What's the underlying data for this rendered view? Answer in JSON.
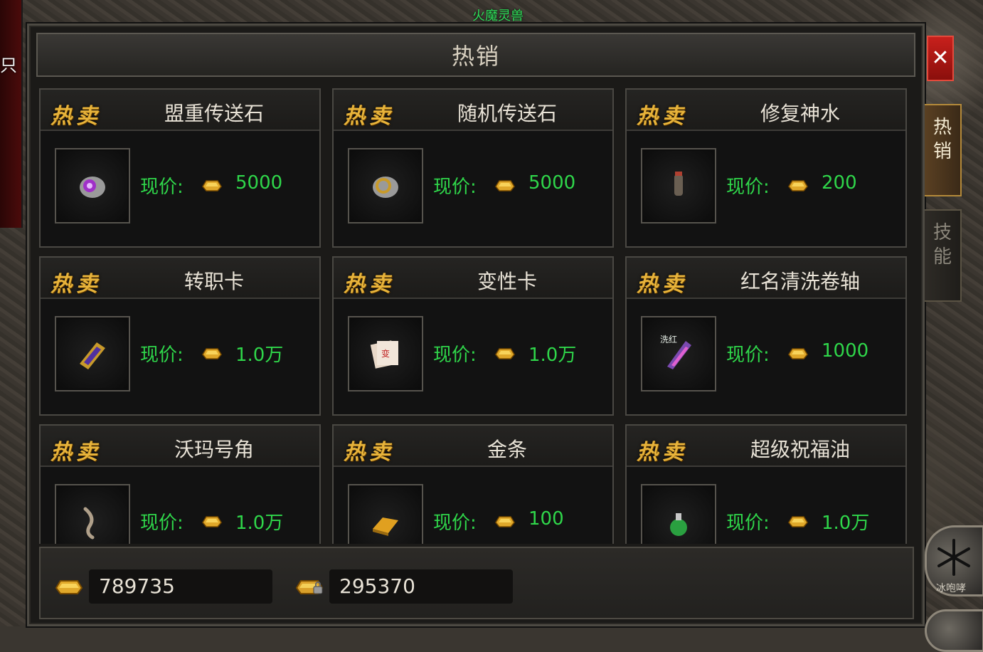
{
  "world": {
    "left_label": "只",
    "npc_name": "火魔灵兽"
  },
  "window": {
    "title": "热销"
  },
  "hot_label": "热卖",
  "price_label": "现价:",
  "items": [
    {
      "name": "盟重传送石",
      "price": "5000",
      "icon": "purple-teleport-stone-icon"
    },
    {
      "name": "随机传送石",
      "price": "5000",
      "icon": "random-teleport-stone-icon"
    },
    {
      "name": "修复神水",
      "price": "200",
      "icon": "repair-potion-icon"
    },
    {
      "name": "转职卡",
      "price": "1.0万",
      "icon": "class-change-card-icon"
    },
    {
      "name": "变性卡",
      "price": "1.0万",
      "icon": "gender-change-card-icon"
    },
    {
      "name": "红名清洗卷轴",
      "price": "1000",
      "icon": "red-name-scroll-icon",
      "icon_text": "洗红"
    },
    {
      "name": "沃玛号角",
      "price": "1.0万",
      "icon": "woma-horn-icon"
    },
    {
      "name": "金条",
      "price": "100",
      "icon": "gold-bar-icon"
    },
    {
      "name": "超级祝福油",
      "price": "1.0万",
      "icon": "blessing-oil-icon"
    }
  ],
  "footer": {
    "gold": "789735",
    "bound_gold": "295370"
  },
  "side_tabs": [
    {
      "label": "热销",
      "active": true
    },
    {
      "label": "技能",
      "active": false
    }
  ],
  "skill": {
    "label": "冰咆哮"
  },
  "colors": {
    "price_green": "#2fd64a",
    "badge_gold": "#e7b33a",
    "close_red": "#c8201c"
  }
}
